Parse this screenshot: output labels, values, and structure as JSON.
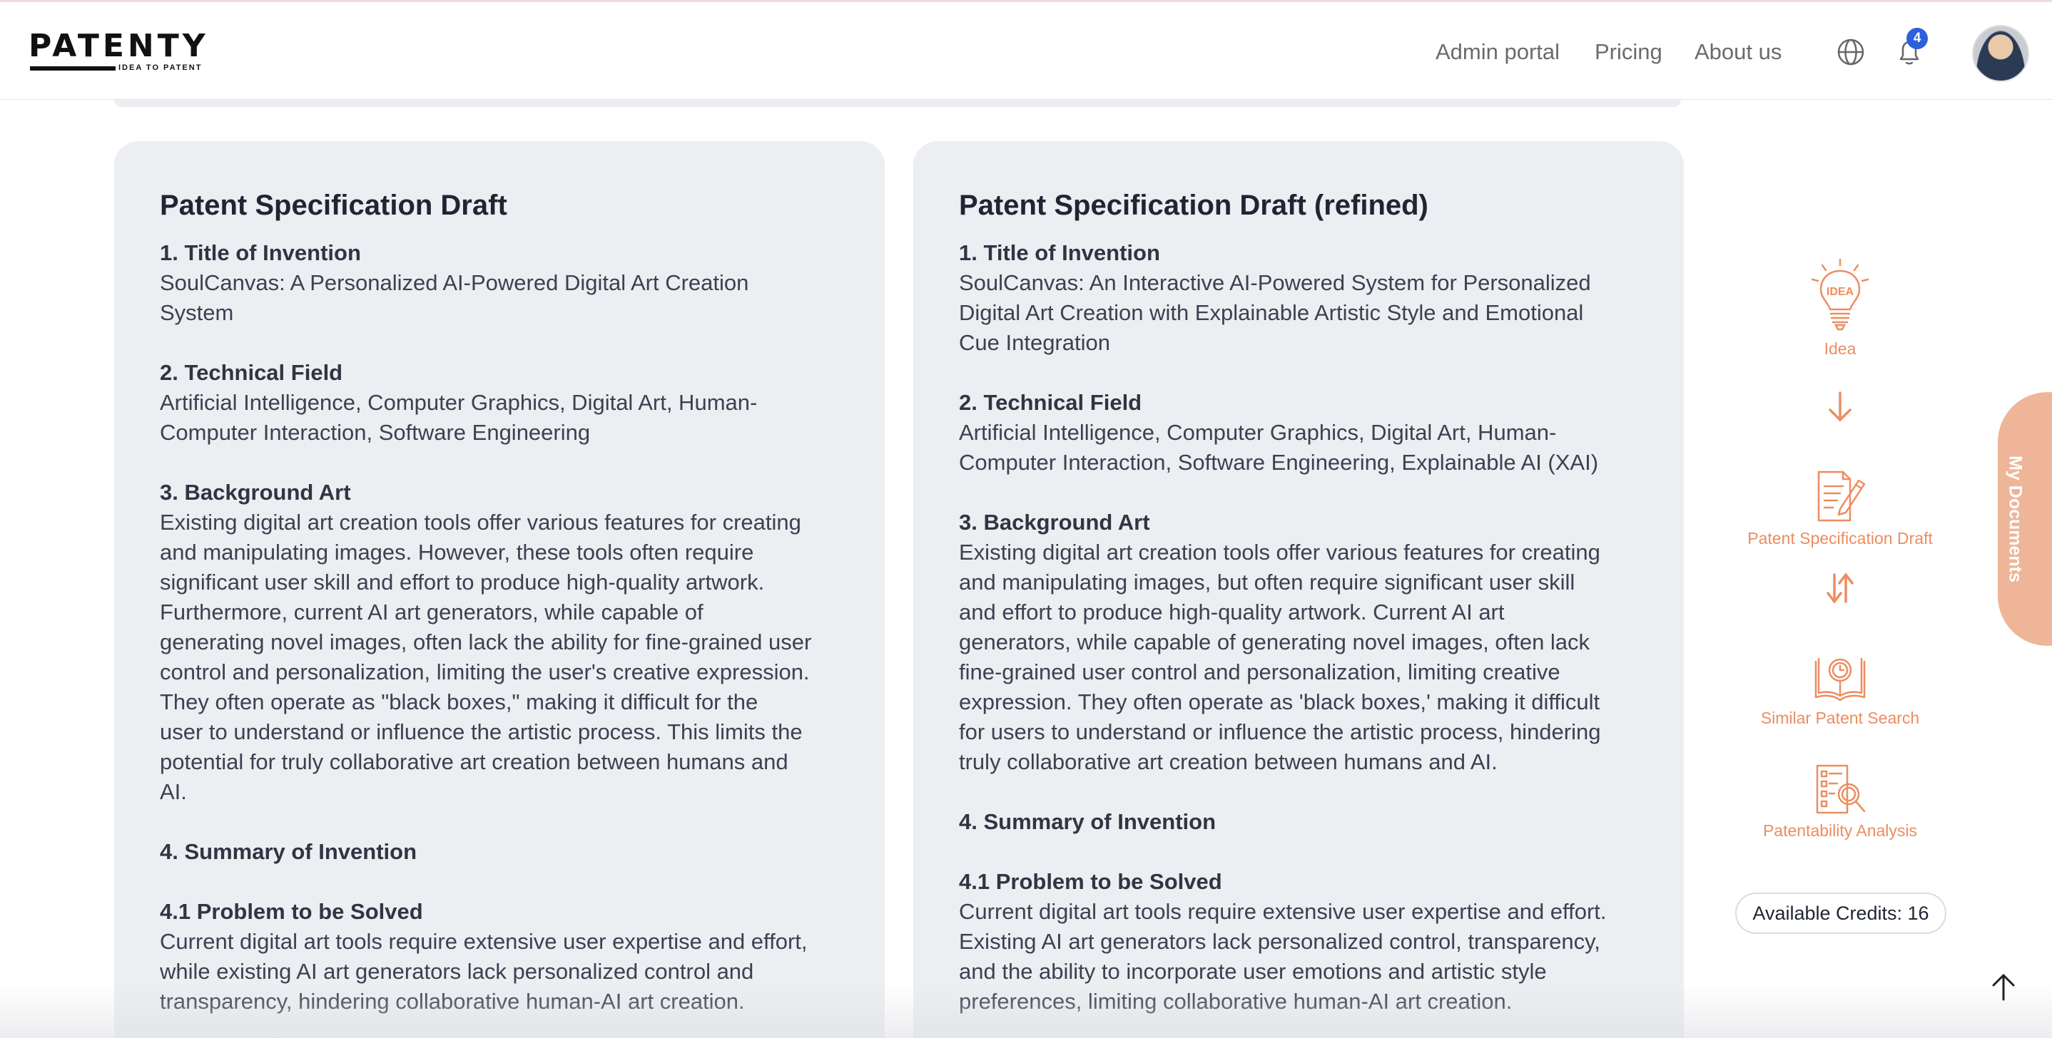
{
  "header": {
    "logo_text": "PATENTY",
    "logo_tagline": "IDEA TO PATENT",
    "nav": {
      "admin": "Admin portal",
      "pricing": "Pricing",
      "about": "About us"
    },
    "notification_count": "4"
  },
  "draft": {
    "title": "Patent Specification Draft",
    "s1_heading": "1. Title of Invention",
    "s1_body": "SoulCanvas: A Personalized AI-Powered Digital Art Creation\nSystem",
    "s2_heading": "2. Technical Field",
    "s2_body": "Artificial Intelligence, Computer Graphics, Digital Art, Human-\nComputer Interaction, Software Engineering",
    "s3_heading": "3. Background Art",
    "s3_body": "Existing digital art creation tools offer various features for creating\nand manipulating images. However, these tools often require\nsignificant user skill and effort to produce high-quality artwork.\n Furthermore, current AI art generators, while capable of\ngenerating novel images, often lack the ability for fine-grained user\ncontrol and personalization, limiting the user's creative expression.\n They often operate as \"black boxes,\" making it difficult for the\nuser to understand or influence the artistic process.  This limits the\npotential for truly collaborative art creation between humans and\nAI.",
    "s4_heading": "4. Summary of Invention",
    "s41_heading": "4.1 Problem to be Solved",
    "s41_body": "Current digital art tools require extensive user expertise and effort,\nwhile existing AI art generators lack personalized control and\ntransparency, hindering collaborative human-AI art creation."
  },
  "refined": {
    "title": "Patent Specification Draft (refined)",
    "s1_heading": "1. Title of Invention",
    "s1_body": "SoulCanvas: An Interactive AI-Powered System for Personalized\nDigital Art Creation with Explainable Artistic Style and Emotional\nCue Integration",
    "s2_heading": "2. Technical Field",
    "s2_body": "Artificial Intelligence, Computer Graphics, Digital Art, Human-\nComputer Interaction, Software Engineering, Explainable AI (XAI)",
    "s3_heading": "3. Background Art",
    "s3_body": "Existing digital art creation tools offer various features for creating\nand manipulating images, but often require significant user skill\nand effort to produce high-quality artwork.  Current AI art\ngenerators, while capable of generating novel images, often lack\nfine-grained user control and personalization, limiting creative\nexpression.  They often operate as 'black boxes,' making it difficult\nfor users to understand or influence the artistic process, hindering\ntruly collaborative art creation between humans and AI.",
    "s4_heading": "4. Summary of Invention",
    "s41_heading": "4.1 Problem to be Solved",
    "s41_body": "Current digital art tools require extensive user expertise and effort.\nExisting AI art generators lack personalized control, transparency,\nand the ability to incorporate user emotions and artistic style\npreferences, limiting collaborative human-AI art creation."
  },
  "workflow": {
    "idea": "Idea",
    "idea_icon_text": "IDEA",
    "draft": "Patent Specification Draft",
    "similar": "Similar Patent Search",
    "analysis": "Patentability Analysis",
    "credits": "Available Credits: 16"
  },
  "my_documents": "My Documents",
  "colors": {
    "accent": "#ec8d60",
    "card_bg": "#eceef1",
    "badge": "#2c5fdd"
  }
}
